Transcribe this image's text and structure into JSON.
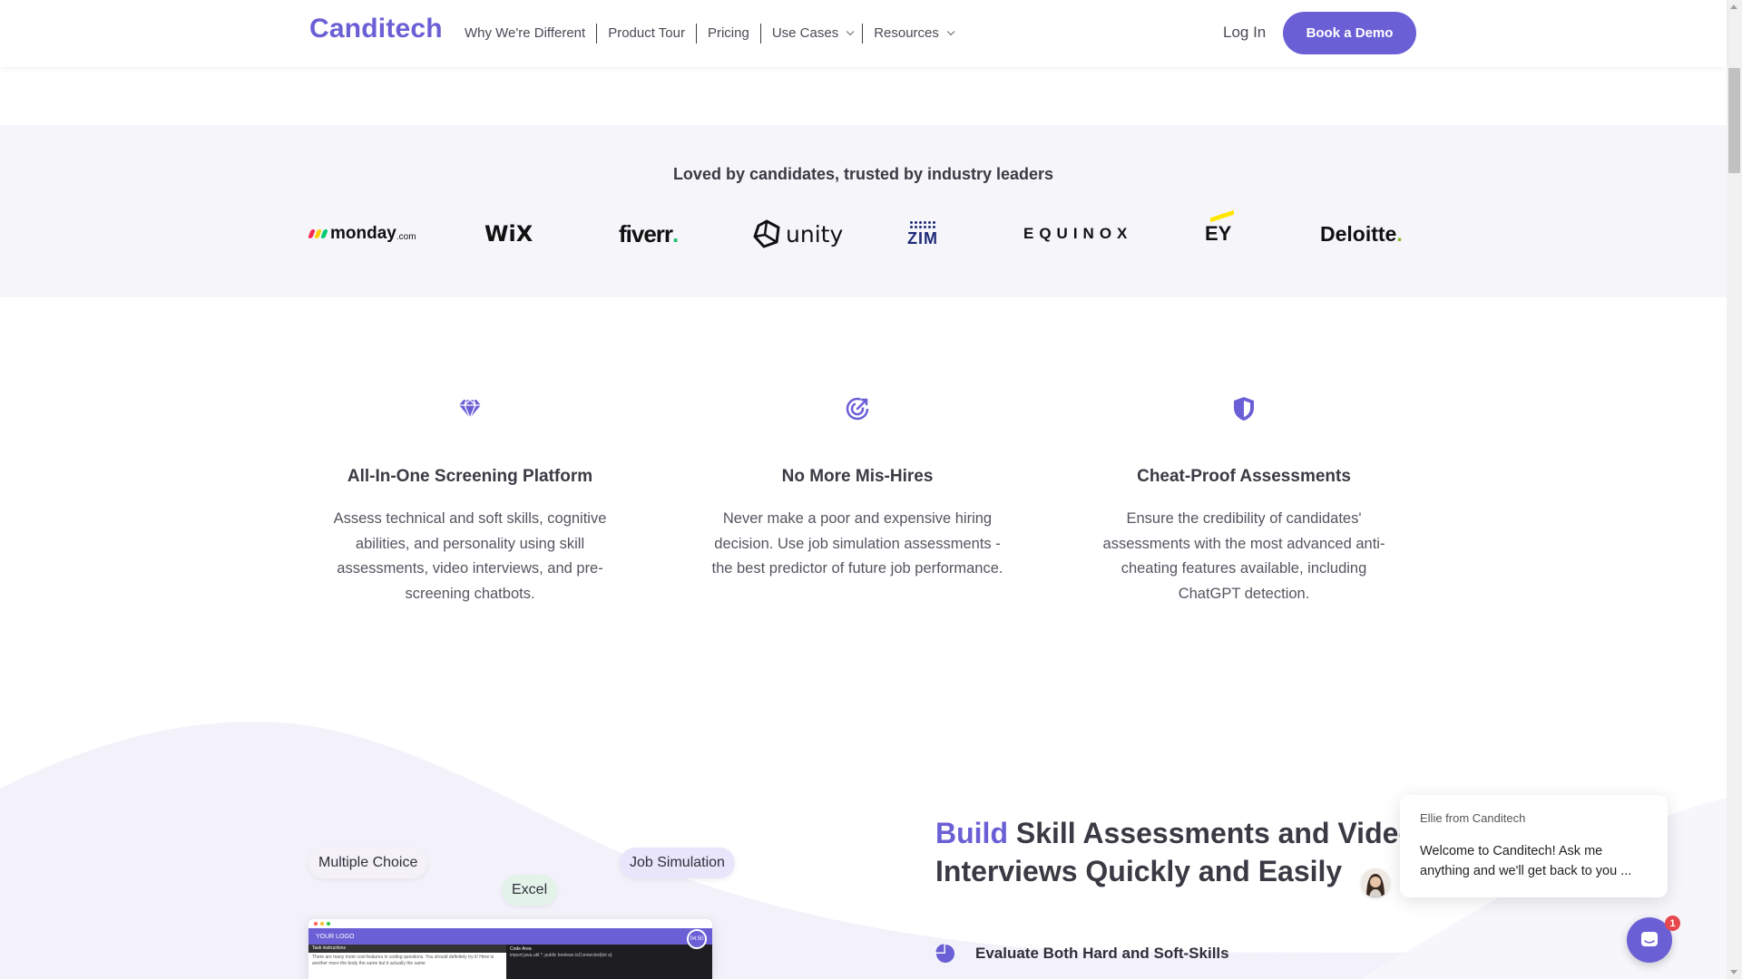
{
  "header": {
    "logo": "Canditech",
    "nav": [
      {
        "label": "Why We're Different",
        "has_dropdown": false
      },
      {
        "label": "Product Tour",
        "has_dropdown": false
      },
      {
        "label": "Pricing",
        "has_dropdown": false
      },
      {
        "label": "Use Cases",
        "has_dropdown": true
      },
      {
        "label": "Resources",
        "has_dropdown": true
      }
    ],
    "login_label": "Log In",
    "demo_label": "Book a Demo"
  },
  "clients": {
    "heading": "Loved by candidates, trusted by industry leaders",
    "logos": [
      {
        "name": "monday",
        "suffix": ".com"
      },
      {
        "name": "WiX"
      },
      {
        "name": "fiverr",
        "suffix": "."
      },
      {
        "name": "unity"
      },
      {
        "name": "ZIM"
      },
      {
        "name": "EQUINOX"
      },
      {
        "name": "EY"
      },
      {
        "name": "Deloitte",
        "suffix": "."
      }
    ]
  },
  "features": [
    {
      "icon": "diamond-icon",
      "title": "All-In-One Screening Platform",
      "body": "Assess technical and soft skills, cognitive abilities, and personality using skill assessments, video interviews, and pre-screening chatbots."
    },
    {
      "icon": "target-arrow-icon",
      "title": "No More Mis-Hires",
      "body": "Never make a poor and expensive hiring decision. Use job simulation assessments - the best predictor of future job performance."
    },
    {
      "icon": "shield-icon",
      "title": "Cheat-Proof Assessments",
      "body": "Ensure the credibility of candidates' assessments with the most advanced anti-cheating features available, including ChatGPT detection."
    }
  ],
  "showcase": {
    "tags": [
      "Multiple Choice",
      "Excel",
      "Job Simulation"
    ],
    "mock": {
      "logo_text": "YOUR LOGO",
      "timer": "04:50",
      "left_title": "Task instructions",
      "left_text": "There are many more cool features in coding questions. You should definitely try it! Here is another more the body the same but it actually the same",
      "right_title": "Code Area",
      "right_text": "import java.util.*; public boolean isConnected(int a)"
    },
    "heading_accent": "Build",
    "heading_rest_line1": " Skill Assessments and Video",
    "heading_line2": "Interviews Quickly and Easily",
    "bullet": "Evaluate Both Hard and Soft-Skills"
  },
  "chat": {
    "from": "Ellie from Canditech",
    "message": "Welcome to Canditech! Ask me anything and we'll get back to you ...",
    "badge": "1"
  },
  "colors": {
    "brand": "#6b5fd6",
    "band_bg": "#f6f5fa",
    "fiverr_green": "#1dbf73",
    "deloitte_green": "#86bc25",
    "ey_yellow": "#ffe600",
    "zim_blue": "#1e2a78"
  }
}
